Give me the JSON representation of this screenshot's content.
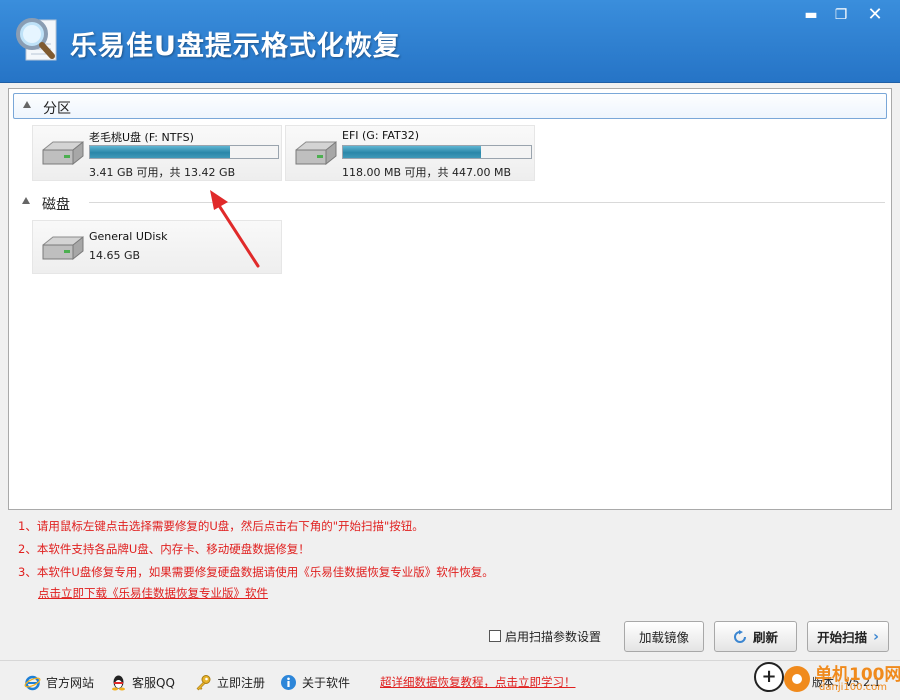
{
  "window": {
    "title": "乐易佳U盘提示格式化恢复",
    "minimize_glyph": "▬",
    "maximize_glyph": "❐",
    "close_glyph": "✕"
  },
  "groups": {
    "partition_label": "分区",
    "disk_label": "磁盘"
  },
  "partitions": [
    {
      "name": "老毛桃U盘 (F: NTFS)",
      "used_fraction": 0.746,
      "info": "3.41 GB 可用，共 13.42 GB"
    },
    {
      "name": "EFI (G: FAT32)",
      "used_fraction": 0.736,
      "info": "118.00 MB 可用，共 447.00 MB"
    }
  ],
  "disks": [
    {
      "name": "General UDisk",
      "info": "14.65 GB"
    }
  ],
  "notes": [
    "1、请用鼠标左键点击选择需要修复的U盘，然后点击右下角的\"开始扫描\"按钮。",
    "2、本软件支持各品牌U盘、内存卡、移动硬盘数据修复！",
    "3、本软件U盘修复专用，如果需要修复硬盘数据请使用《乐易佳数据恢复专业版》软件恢复。"
  ],
  "download_link": "点击立即下载《乐易佳数据恢复专业版》软件",
  "actions": {
    "scan_settings_label": "启用扫描参数设置",
    "load_image": "加载镜像",
    "refresh": "刷新",
    "start_scan": "开始扫描",
    "start_scan_chevron": "›"
  },
  "statusbar": {
    "site": "官方网站",
    "qq": "客服QQ",
    "register": "立即注册",
    "about": "关于软件",
    "tutorial": "超详细数据恢复教程，点击立即学习！",
    "version": "版本：V5.2.1"
  },
  "watermark": {
    "plus_glyph": "+",
    "title": "单机100网",
    "url": "danji100.com"
  },
  "colors": {
    "titlebar": "#2f80d1",
    "usage_fill": "#2b87a9",
    "note_red": "#e0201f",
    "annotation_arrow": "#e02a2a"
  }
}
